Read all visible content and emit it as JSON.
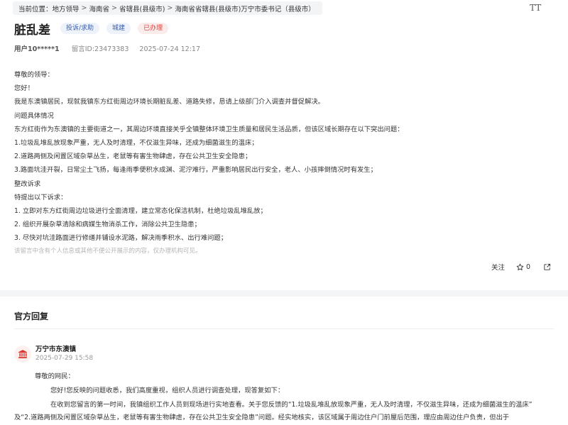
{
  "breadcrumb": {
    "prefix": "当前位置：",
    "items": [
      "地方领导",
      "海南省",
      "省辖县(县级市)",
      "海南省省辖县(县级市)万宁市委书记（县级市）"
    ],
    "sep": ">"
  },
  "font_toggle": "TT",
  "post": {
    "title": "脏乱差",
    "tags": [
      "投诉/求助",
      "城建",
      "已办理"
    ],
    "user": "用户10*****1",
    "message_id": "留言ID:23473383",
    "time": "2025-07-24 12:17",
    "lines": [
      "尊敬的领导：",
      "您好！",
      "我是东澳镇居民，现就我镇东方红街周边环境长期脏乱差、道路失修，恳请上级部门介入调查并督促解决。",
      "问题具体情况",
      "东方红街作为东澳镇的主要街道之一，其周边环境直接关乎全镇整体环境卫生质量和居民生活品质，但该区域长期存在以下突出问题：",
      "1.垃圾乱堆乱放现象严重，无人及时清理，不仅滋生异味，还成为细菌滋生的温床；",
      "2.道路两侧及闲置区域杂草丛生，老鼠等有害生物肆虐，存在公共卫生安全隐患；",
      "3.路面坑洼开裂，日常尘土飞扬，每逢雨季便积水成渊、泥泞难行，严重影响居民出行安全，老人、小孩摔倒情况时有发生；",
      "整改诉求",
      "特提出以下诉求：",
      "1. 立即对东方红街周边垃圾进行全面清理，建立常态化保洁机制，杜绝垃圾乱堆乱放；",
      "2. 组织开展杂草清除和病媒生物消杀工作，消除公共卫生隐患；",
      "3. 尽快对坑洼路面进行修缮并铺设水泥路，解决雨季积水、出行难问题；"
    ],
    "notice": "该留言中含有个人信息或其他不便公开展示的内容，仅办理机构可见。"
  },
  "actions": {
    "follow": "关注",
    "like_count": "0"
  },
  "reply": {
    "heading": "官方回复",
    "org": "万宁市东澳镇",
    "date": "2025-07-29 15:58",
    "lines": [
      "尊敬的网民：",
      "您好!您反映的问题收悉，我们高度重视，组织人员进行调查处理，现答复如下：",
      "在收到您留言的第一时间，我镇组织工作人员到现场进行实地查看。关于您反馈的“1.垃圾乱堆乱放现象严重，无人及时清理，不仅滋生异味，还成为细菌滋生的温床”"
    ],
    "last_line": "及“2.道路两侧及闲置区域杂草丛生，老鼠等有害生物肆虐，存在公共卫生安全隐患”问题。经实地核实，该区域属于周边住户门前屋后范围，理应由周边住户负责，但出于"
  },
  "colors": {
    "tag_blue_bg": "#eef2fa",
    "tag_blue_text": "#3b5fa8",
    "tag_red_bg": "#fbecec",
    "tag_red_text": "#e0403a",
    "accent_red": "#d9362e"
  }
}
